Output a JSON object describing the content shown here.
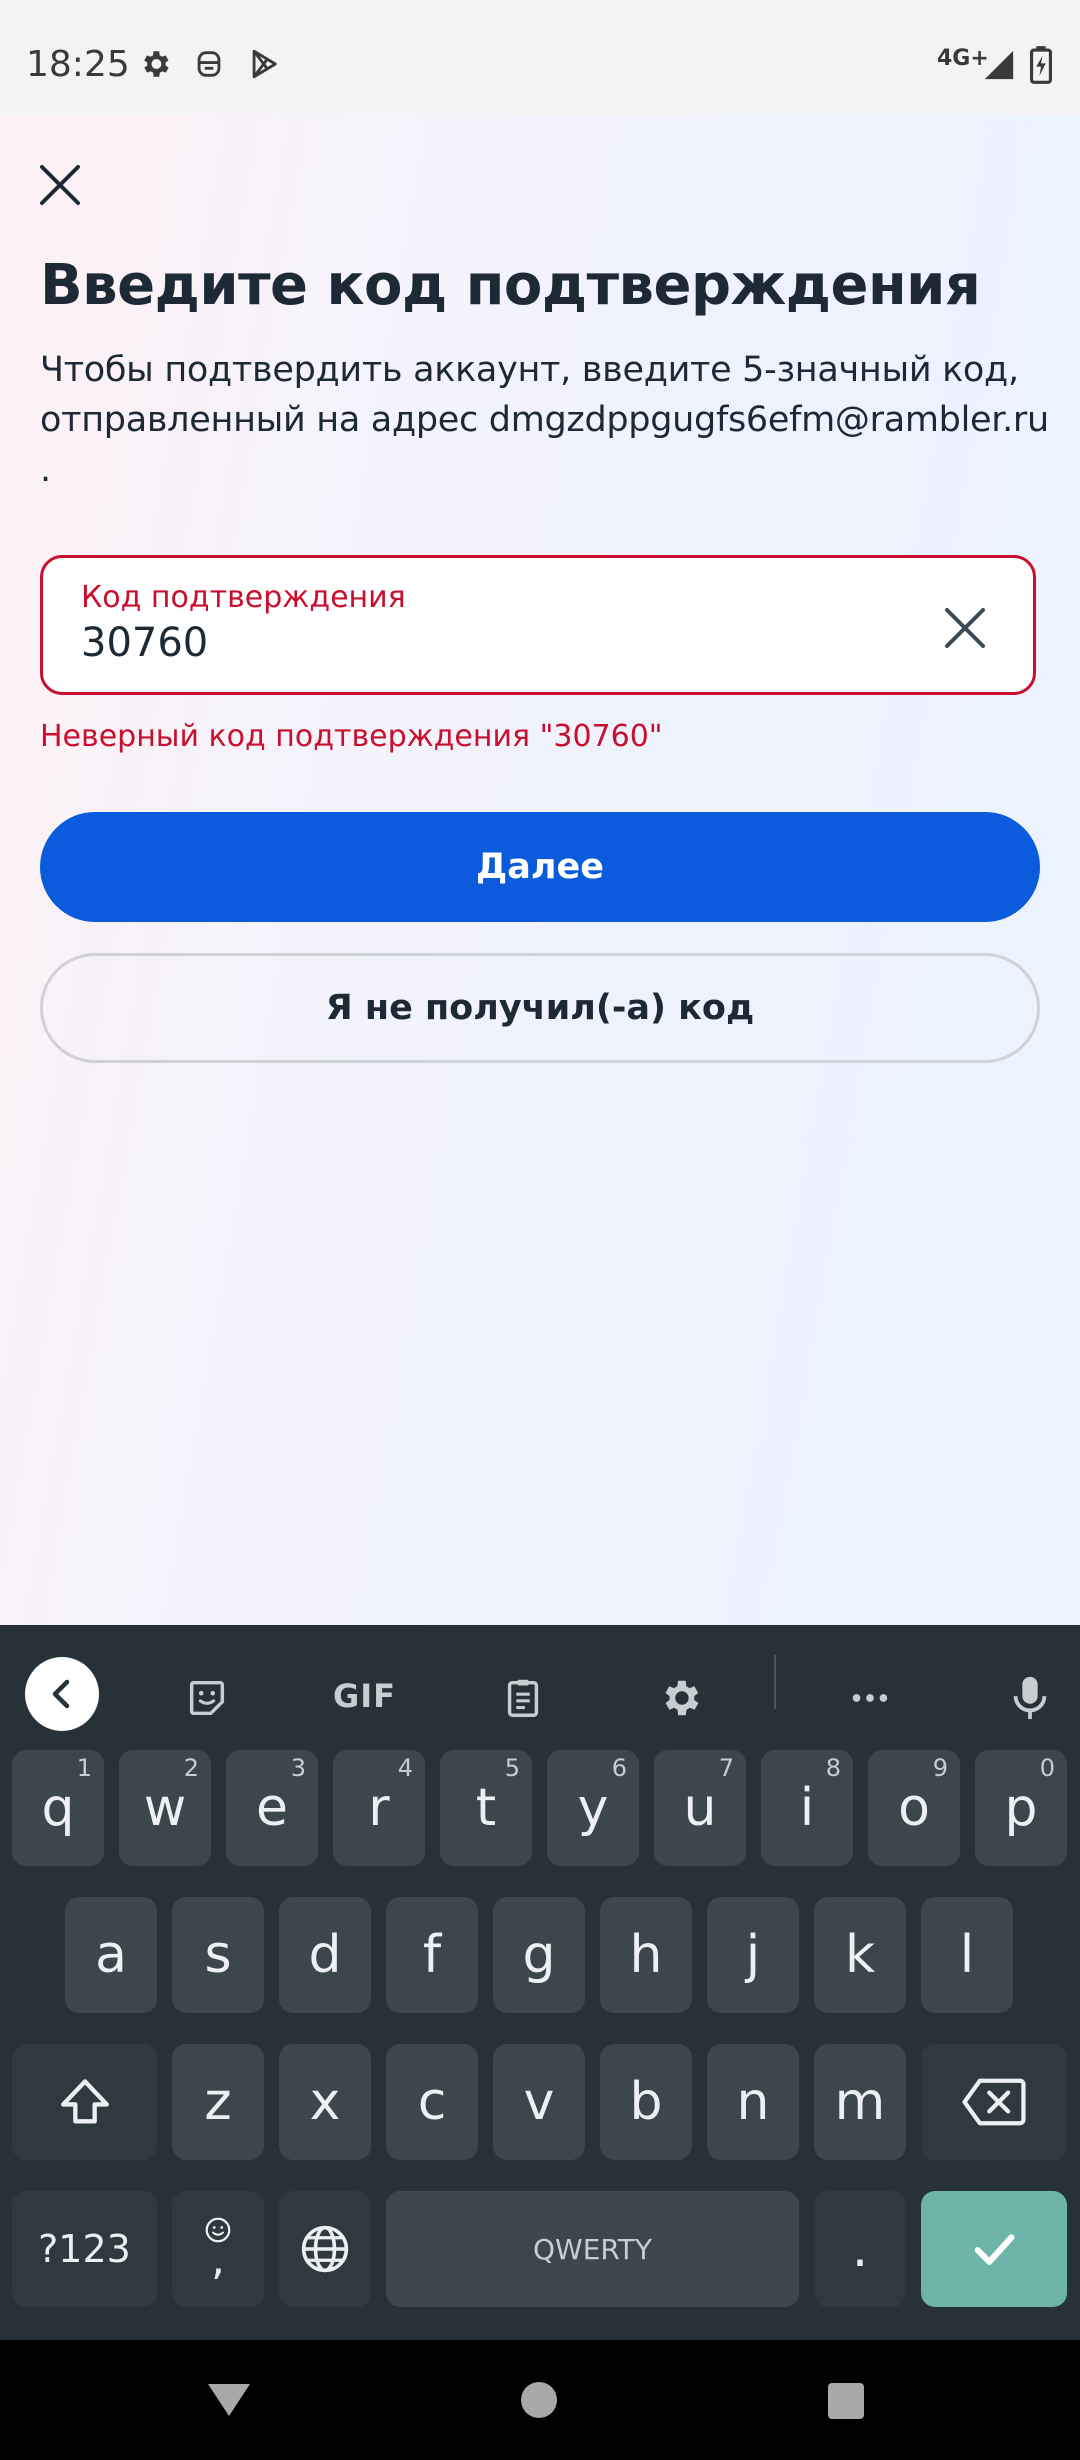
{
  "status_bar": {
    "time": "18:25",
    "network": "4G+",
    "icons": [
      "gear-icon",
      "mail-robot-icon",
      "play-store-icon",
      "signal-icon",
      "battery-icon"
    ]
  },
  "screen": {
    "title": "Введите код подтверждения",
    "description_lines": [
      "Чтобы подтвердить аккаунт, введите 5-значный код,",
      "отправленный на адрес dmgzdppgugfs6efm@rambler.ru",
      "."
    ],
    "code_field": {
      "label": "Код подтверждения",
      "value": "30760"
    },
    "error": "Неверный код подтверждения \"30760\"",
    "primary_button": "Далее",
    "secondary_button": "Я не получил(-а) код"
  },
  "keyboard": {
    "toolbar": {
      "gif_label": "GIF"
    },
    "row1": [
      {
        "key": "q",
        "hint": "1"
      },
      {
        "key": "w",
        "hint": "2"
      },
      {
        "key": "e",
        "hint": "3"
      },
      {
        "key": "r",
        "hint": "4"
      },
      {
        "key": "t",
        "hint": "5"
      },
      {
        "key": "y",
        "hint": "6"
      },
      {
        "key": "u",
        "hint": "7"
      },
      {
        "key": "i",
        "hint": "8"
      },
      {
        "key": "o",
        "hint": "9"
      },
      {
        "key": "p",
        "hint": "0"
      }
    ],
    "row2": [
      "a",
      "s",
      "d",
      "f",
      "g",
      "h",
      "j",
      "k",
      "l"
    ],
    "row3": [
      "z",
      "x",
      "c",
      "v",
      "b",
      "n",
      "m"
    ],
    "symbols_key": "?123",
    "comma_key": ",",
    "space_label": "QWERTY",
    "period_key": "."
  },
  "colors": {
    "primary": "#0a5cdc",
    "error": "#c8102e",
    "keyboard_bg": "#263238",
    "key_bg": "#3b464d",
    "enter_key": "#6db5a8"
  }
}
